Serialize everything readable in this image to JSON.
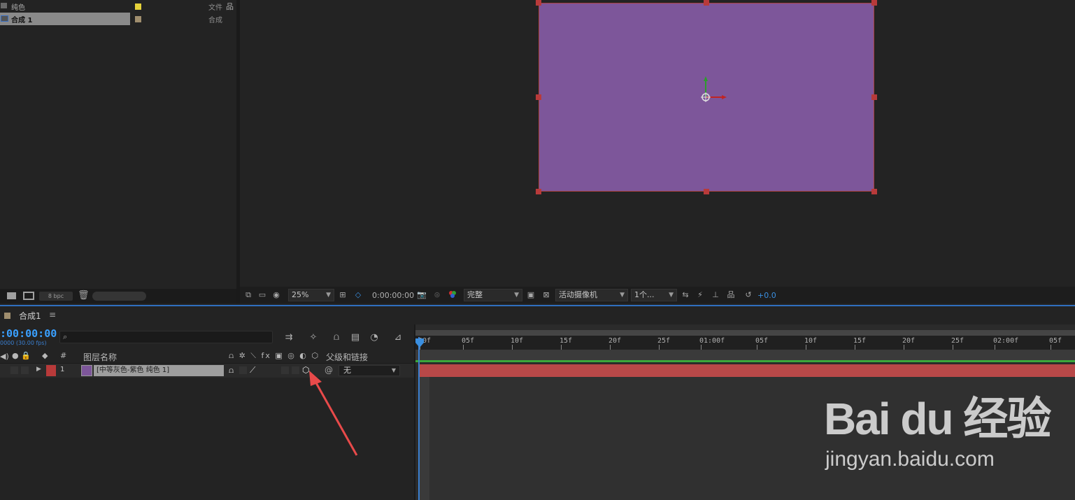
{
  "project_panel": {
    "items": [
      {
        "name": "纯色",
        "type": "文件",
        "color": "#e6d23a",
        "selected": false
      },
      {
        "name": "合成 1",
        "type": "合成",
        "color": "#a08e6e",
        "selected": true
      }
    ],
    "bpc_label": "8 bpc"
  },
  "viewer": {
    "solid_color": "#7d569a",
    "zoom": "25%",
    "timecode": "0:00:00:00",
    "resolution": "完整",
    "camera": "活动摄像机",
    "views": "1个...",
    "exposure": "+0.0"
  },
  "timeline": {
    "tab_label": "合成1",
    "timecode": ":00:00:00",
    "fps_label": "0000 (30.00 fps)",
    "search_placeholder": "",
    "columns": {
      "layer_name": "图层名称",
      "number": "#",
      "parent": "父级和链接"
    },
    "layers": [
      {
        "number": "1",
        "name": "[中等灰色-紫色 纯色 1]",
        "label_color": "#b83a3a",
        "swatch_color": "#7d569a",
        "parent": "无"
      }
    ],
    "ruler_ticks": [
      "00f",
      "05f",
      "10f",
      "15f",
      "20f",
      "25f",
      "01:00f",
      "05f",
      "10f",
      "15f",
      "20f",
      "25f",
      "02:00f",
      "05f"
    ]
  },
  "watermark": {
    "logo": "Bai du 经验",
    "url": "jingyan.baidu.com"
  }
}
